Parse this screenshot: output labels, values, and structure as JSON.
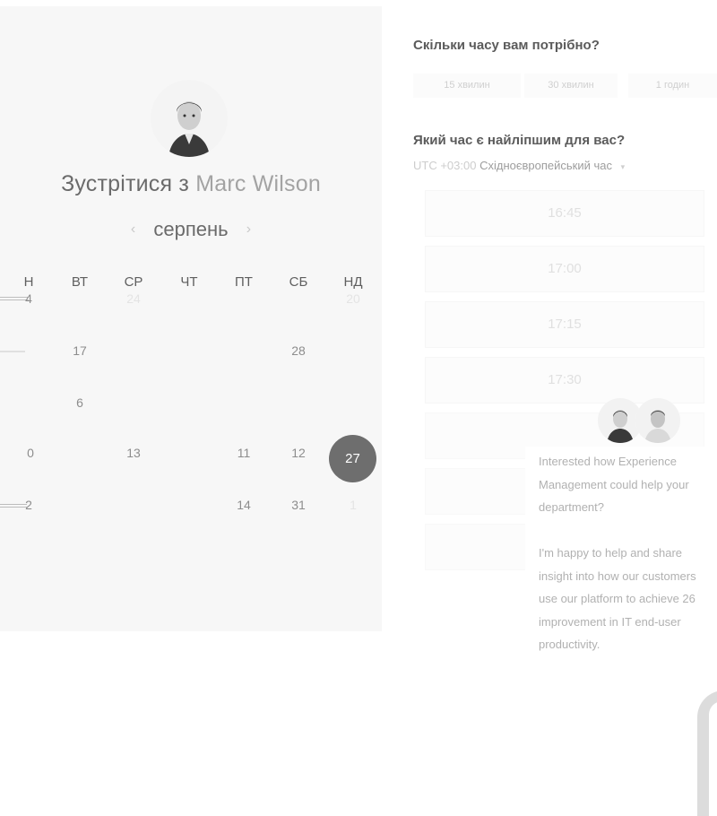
{
  "left": {
    "title_prefix": "Зустрітися з",
    "title_name": "Marc Wilson",
    "month": "серпень",
    "prev_arrow": "‹",
    "next_arrow": "›",
    "weekdays": [
      "Н",
      "ВТ",
      "СР",
      "ЧТ",
      "ПТ",
      "СБ",
      "НД"
    ],
    "rows": [
      [
        "4",
        "",
        "24",
        "",
        "",
        "",
        "20"
      ],
      [
        "",
        "17",
        "",
        "",
        "",
        "28",
        ""
      ],
      [
        "",
        "6",
        "",
        "",
        "",
        "",
        ""
      ],
      [
        "0",
        "",
        "13",
        "",
        "11",
        "12",
        "27"
      ],
      [
        "2",
        "",
        "",
        "",
        "14",
        "31",
        "1"
      ]
    ],
    "selected_day": "27"
  },
  "right": {
    "duration_question": "Скільки часу вам потрібно?",
    "durations": [
      "15 хвилин",
      "30 хвилин",
      "1 годин"
    ],
    "time_question": "Який час є найліпшим для вас?",
    "timezone_offset": "UTC +03:00",
    "timezone_name": "Східноєвропейський час",
    "timezone_caret": "▾",
    "slots": [
      "16:45",
      "17:00",
      "17:15",
      "17:30"
    ]
  },
  "chat": {
    "message": "Interested how Experience\nManagement could help your\ndepartment?\n\nI'm happy to help and share\ninsight into how our customers\nuse our platform to achieve 26\nimprovement in IT end-user\nproductivity."
  },
  "icons": {
    "host_avatar": "person-avatar",
    "chat_avatars": [
      "person-avatar",
      "person-avatar"
    ],
    "launcher": "chat-launcher-icon"
  }
}
